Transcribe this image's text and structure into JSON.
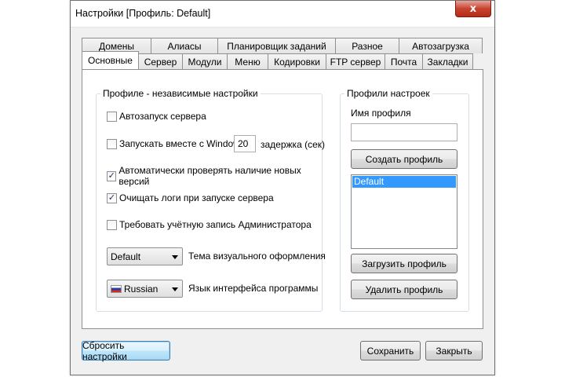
{
  "window": {
    "title": "Настройки [Профиль: Default]",
    "close_glyph": "x"
  },
  "tabs_back": [
    "Домены",
    "Алиасы",
    "Планировщик заданий",
    "Разное",
    "Автозагрузка"
  ],
  "tabs_front": [
    "Основные",
    "Сервер",
    "Модули",
    "Меню",
    "Кодировки",
    "FTP сервер",
    "Почта",
    "Закладки"
  ],
  "main": {
    "group_title": "Профиле - независимые настройки",
    "autostart_label": "Автозапуск сервера",
    "autostart_checked": false,
    "with_windows_label": "Запускать вместе с Windows",
    "with_windows_checked": false,
    "delay_value": "20",
    "delay_label": "задержка (сек)",
    "check_updates_label": "Автоматически проверять наличие новых версий",
    "check_updates_checked": true,
    "clear_logs_label": "Очищать логи при запуске сервера",
    "clear_logs_checked": true,
    "require_admin_label": "Требовать учётную запись Администратора",
    "require_admin_checked": false,
    "theme_value": "Default",
    "theme_label": "Тема визуального оформления",
    "lang_value": "Russian",
    "lang_label": "Язык интерфейса программы"
  },
  "profiles": {
    "group_title": "Профили настроек",
    "name_label": "Имя профиля",
    "name_value": "",
    "create_button": "Создать профиль",
    "list": [
      "Default"
    ],
    "load_button": "Загрузить профиль",
    "delete_button": "Удалить профиль"
  },
  "footer": {
    "reset_button": "Сбросить настройки",
    "save_button": "Сохранить",
    "close_button": "Закрыть"
  },
  "check_glyph": "✓",
  "colors": {
    "selection": "#3399ff",
    "close_button": "#c7432f"
  }
}
